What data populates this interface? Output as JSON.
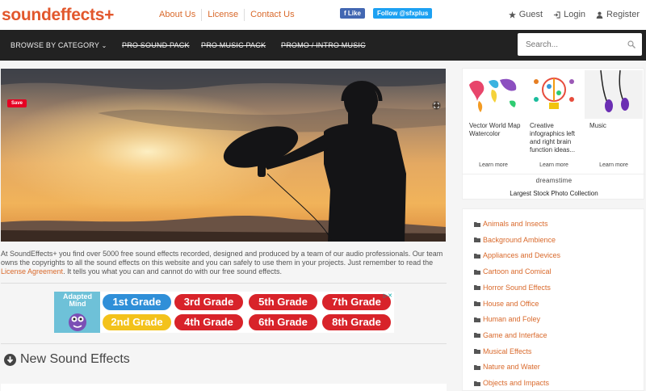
{
  "header": {
    "logo": "soundeffects+",
    "links": [
      "About Us",
      "License",
      "Contact Us"
    ],
    "facebook_like": "f Like",
    "twitter_follow": "Follow @sfxplus",
    "guest": "Guest",
    "login": "Login",
    "register": "Register"
  },
  "nav": {
    "browse": "BROWSE BY CATEGORY",
    "items": [
      "PRO SOUND PACK",
      "PRO MUSIC PACK",
      "PROMO / INTRO MUSIC"
    ],
    "search_placeholder": "Search..."
  },
  "hero": {
    "save_label": "Save"
  },
  "intro": {
    "text_before": "At SoundEffects+ you find over 5000 free sound effects recorded, designed and produced by a team of our audio professionals. Our team owns the copyrights to all the sound effects on this website and you can safely to use them in your projects. Just remember to read the ",
    "link": "License Agreement",
    "text_after": ". It tells you what you can and cannot do with our free sound effects."
  },
  "ad_banner": {
    "brand": "Adapted Mind",
    "grades": [
      "1st Grade",
      "3rd Grade",
      "5th Grade",
      "7th Grade",
      "2nd Grade",
      "4th Grade",
      "6th Grade",
      "8th Grade"
    ],
    "colors": {
      "blue": "#2f8fd8",
      "yellow": "#f3c21b",
      "red": "#d8232a"
    }
  },
  "section": {
    "new_sound_effects": "New Sound Effects"
  },
  "sidebar_ad": {
    "cards": [
      {
        "caption": "Vector World Map Watercolor",
        "more": "Learn more"
      },
      {
        "caption": "Creative infographics left and right brain function ideas...",
        "more": "Learn more"
      },
      {
        "caption": "Music",
        "more": "Learn more"
      }
    ],
    "logo": "dreamstime",
    "tagline": "Largest Stock Photo Collection"
  },
  "categories": [
    "Animals and Insects",
    "Background Ambience",
    "Appliances and Devices",
    "Cartoon and Comical",
    "Horror Sound Effects",
    "House and Office",
    "Human and Foley",
    "Game and Interface",
    "Musical Effects",
    "Nature and Water",
    "Objects and Impacts"
  ],
  "colors": {
    "accent": "#d9692b",
    "logo": "#e2572c",
    "nav_bg": "#222222"
  }
}
